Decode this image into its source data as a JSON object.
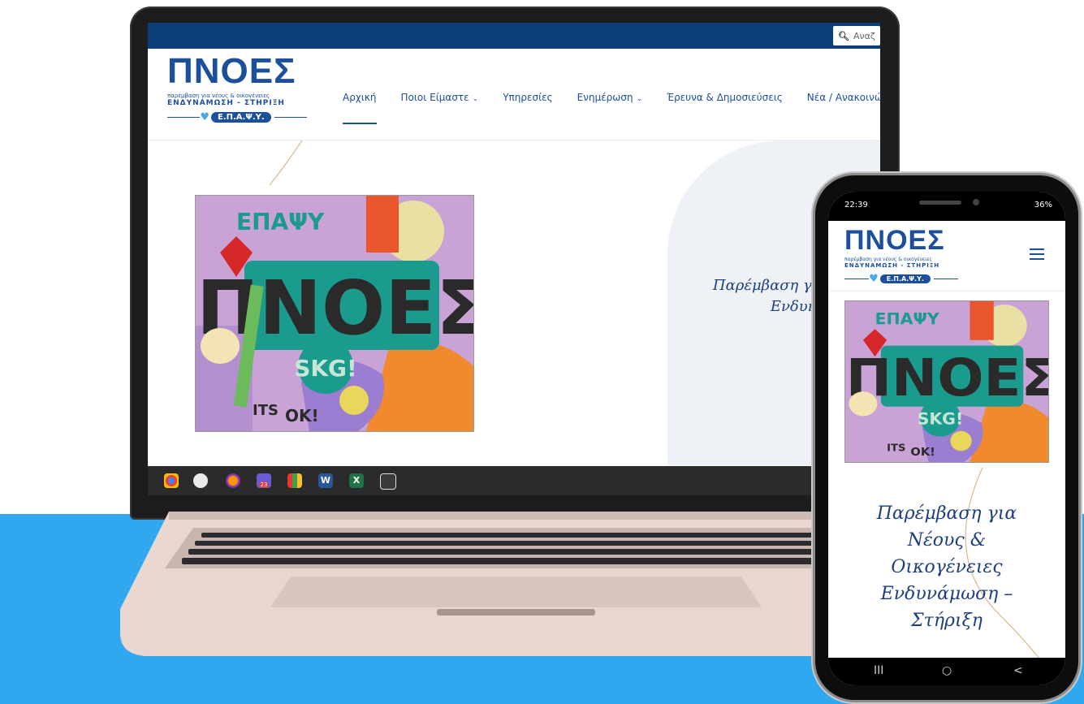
{
  "laptop": {
    "search_placeholder": "Αναζ",
    "logo": {
      "mark": "ΠΝΟΕΣ",
      "sub1": "παρέμβαση για νέους & οικογένειες",
      "sub2": "ΕΝΔΥΝΑΜΩΣΗ - ΣΤΗΡΙΞΗ",
      "badge": "Ε.Π.Α.Ψ.Υ."
    },
    "nav": [
      {
        "label": "Αρχική"
      },
      {
        "label": "Ποιοι Είμαστε"
      },
      {
        "label": "Υπηρεσίες"
      },
      {
        "label": "Ενημέρωση"
      },
      {
        "label": "Έρευνα & Δημοσιεύσεις"
      },
      {
        "label": "Νέα / Ανακοινώ"
      }
    ],
    "hero": {
      "line1": "Παρέμβαση για Νέους",
      "line2": "Ενδυνάμωση –"
    },
    "taskbar_badge": "23"
  },
  "phone": {
    "status_time": "22:39",
    "status_battery": "36%",
    "logo": {
      "mark": "ΠΝΟΕΣ",
      "sub1": "παρέμβαση για νέους & οικογένειες",
      "sub2": "ΕΝΔΥΝΑΜΩΣΗ - ΣΤΗΡΙΞΗ",
      "badge": "Ε.Π.Α.Ψ.Υ."
    },
    "hero": {
      "l1": "Παρέμβαση για",
      "l2": "Νέους &",
      "l3": "Οικογένειες",
      "l4": "Ενδυνάμωση –",
      "l5": "Στήριξη"
    },
    "nav_recent": "III",
    "nav_home": "○",
    "nav_back": "<"
  },
  "art_text": {
    "top": "ΕΠΑΨΥ",
    "main": "ΠΝΟΕΣ",
    "tag": "SKG!",
    "its": "ITS",
    "ok": "OK!"
  },
  "colors": {
    "brand_blue": "#1c4f9c",
    "topbar": "#0b3d78",
    "stage": "#2fa8f0"
  }
}
